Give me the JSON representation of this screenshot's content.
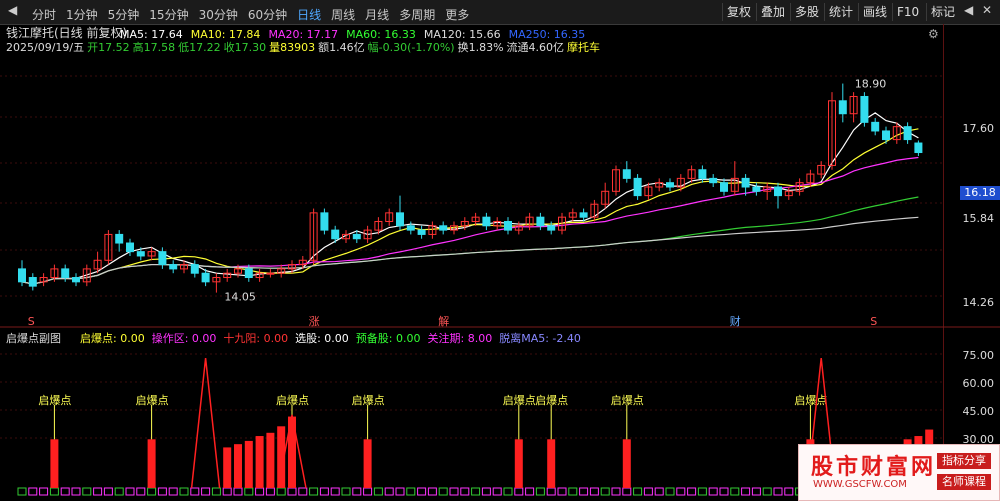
{
  "toolbar": {
    "tabs": [
      "分时",
      "1分钟",
      "5分钟",
      "15分钟",
      "30分钟",
      "60分钟",
      "日线",
      "周线",
      "月线",
      "多周期",
      "更多"
    ],
    "active": "日线",
    "right_buttons": [
      "复权",
      "叠加",
      "多股",
      "统计",
      "画线",
      "F10",
      "标记"
    ]
  },
  "header": {
    "name": "钱江摩托(日线 前复权)",
    "ma_values": [
      {
        "label": "MA5: 17.64",
        "color": "#ffffff"
      },
      {
        "label": "MA10: 17.84",
        "color": "#ffff33"
      },
      {
        "label": "MA20: 17.17",
        "color": "#ff33ff"
      },
      {
        "label": "MA60: 16.33",
        "color": "#33ff33"
      },
      {
        "label": "MA120: 15.66",
        "color": "#dddddd"
      },
      {
        "label": "MA250: 16.35",
        "color": "#3366ff"
      }
    ],
    "quote": [
      {
        "t": "2025/09/19/五",
        "c": "#dddddd"
      },
      {
        "t": "开17.52",
        "c": "#33cc33"
      },
      {
        "t": "高17.58",
        "c": "#33cc33"
      },
      {
        "t": "低17.22",
        "c": "#33cc33"
      },
      {
        "t": "收17.30",
        "c": "#33cc33"
      },
      {
        "t": "量83903",
        "c": "#ffff33"
      },
      {
        "t": "额1.46亿",
        "c": "#dddddd"
      },
      {
        "t": "幅-0.30(-1.70%)",
        "c": "#33cc33"
      },
      {
        "t": "换1.83%",
        "c": "#dddddd"
      },
      {
        "t": "流通4.60亿",
        "c": "#dddddd"
      },
      {
        "t": "摩托车",
        "c": "#ffff33"
      }
    ]
  },
  "price_axis": {
    "labels": [
      "17.60",
      "15.84",
      "14.26"
    ],
    "highlight": "16.18"
  },
  "annotations": {
    "high": "18.90",
    "low": "14.05",
    "events": [
      "S",
      "涨",
      "解",
      "财",
      "S"
    ]
  },
  "sub_header": {
    "title": "启爆点副图",
    "items": [
      {
        "t": "启爆点: 0.00",
        "c": "#ffff33"
      },
      {
        "t": "操作区: 0.00",
        "c": "#ff33ff"
      },
      {
        "t": "十九阳: 0.00",
        "c": "#ff3333"
      },
      {
        "t": "选股: 0.00",
        "c": "#ffffff"
      },
      {
        "t": "预备股: 0.00",
        "c": "#33ff33"
      },
      {
        "t": "关注期: 8.00",
        "c": "#ff33ff"
      },
      {
        "t": "脱离MA5: -2.40",
        "c": "#8888ff"
      }
    ]
  },
  "sub_axis": {
    "labels": [
      "75.00",
      "60.00",
      "45.00",
      "30.00"
    ]
  },
  "signal_label": "启爆点",
  "watermark": {
    "name": "股市财富网",
    "url": "WWW.GSCFW.COM",
    "tag1": "指标分享",
    "tag2": "名师课程"
  },
  "chart_data": {
    "type": "candlestick",
    "y_range": [
      13.6,
      19.4
    ],
    "candles": [
      {
        "o": 14.6,
        "c": 14.3,
        "h": 14.8,
        "l": 14.2
      },
      {
        "o": 14.4,
        "c": 14.2,
        "h": 14.5,
        "l": 14.1
      },
      {
        "o": 14.3,
        "c": 14.4,
        "h": 14.5,
        "l": 14.2
      },
      {
        "o": 14.4,
        "c": 14.6,
        "h": 14.7,
        "l": 14.3
      },
      {
        "o": 14.6,
        "c": 14.4,
        "h": 14.7,
        "l": 14.3
      },
      {
        "o": 14.4,
        "c": 14.3,
        "h": 14.5,
        "l": 14.2
      },
      {
        "o": 14.3,
        "c": 14.6,
        "h": 14.7,
        "l": 14.2
      },
      {
        "o": 14.6,
        "c": 14.8,
        "h": 15.0,
        "l": 14.5
      },
      {
        "o": 14.8,
        "c": 15.4,
        "h": 15.5,
        "l": 14.7
      },
      {
        "o": 15.4,
        "c": 15.2,
        "h": 15.5,
        "l": 15.0
      },
      {
        "o": 15.2,
        "c": 15.0,
        "h": 15.3,
        "l": 14.9
      },
      {
        "o": 15.0,
        "c": 14.9,
        "h": 15.1,
        "l": 14.8
      },
      {
        "o": 14.9,
        "c": 15.0,
        "h": 15.1,
        "l": 14.8
      },
      {
        "o": 15.0,
        "c": 14.7,
        "h": 15.1,
        "l": 14.6
      },
      {
        "o": 14.7,
        "c": 14.6,
        "h": 14.8,
        "l": 14.5
      },
      {
        "o": 14.6,
        "c": 14.7,
        "h": 14.8,
        "l": 14.5
      },
      {
        "o": 14.7,
        "c": 14.5,
        "h": 14.8,
        "l": 14.4
      },
      {
        "o": 14.5,
        "c": 14.3,
        "h": 14.6,
        "l": 14.2
      },
      {
        "o": 14.3,
        "c": 14.4,
        "h": 14.5,
        "l": 14.05
      },
      {
        "o": 14.4,
        "c": 14.5,
        "h": 14.6,
        "l": 14.3
      },
      {
        "o": 14.5,
        "c": 14.6,
        "h": 14.7,
        "l": 14.4
      },
      {
        "o": 14.6,
        "c": 14.4,
        "h": 14.7,
        "l": 14.3
      },
      {
        "o": 14.4,
        "c": 14.5,
        "h": 14.6,
        "l": 14.3
      },
      {
        "o": 14.5,
        "c": 14.5,
        "h": 14.6,
        "l": 14.4
      },
      {
        "o": 14.5,
        "c": 14.6,
        "h": 14.7,
        "l": 14.4
      },
      {
        "o": 14.6,
        "c": 14.7,
        "h": 14.8,
        "l": 14.5
      },
      {
        "o": 14.7,
        "c": 14.8,
        "h": 14.9,
        "l": 14.6
      },
      {
        "o": 14.8,
        "c": 15.9,
        "h": 16.0,
        "l": 14.7
      },
      {
        "o": 15.9,
        "c": 15.5,
        "h": 16.0,
        "l": 15.4
      },
      {
        "o": 15.5,
        "c": 15.3,
        "h": 15.6,
        "l": 15.2
      },
      {
        "o": 15.3,
        "c": 15.4,
        "h": 15.5,
        "l": 15.2
      },
      {
        "o": 15.4,
        "c": 15.3,
        "h": 15.5,
        "l": 15.2
      },
      {
        "o": 15.3,
        "c": 15.5,
        "h": 15.6,
        "l": 15.2
      },
      {
        "o": 15.5,
        "c": 15.7,
        "h": 15.8,
        "l": 15.4
      },
      {
        "o": 15.7,
        "c": 15.9,
        "h": 16.0,
        "l": 15.6
      },
      {
        "o": 15.9,
        "c": 15.6,
        "h": 16.3,
        "l": 15.5
      },
      {
        "o": 15.6,
        "c": 15.5,
        "h": 15.7,
        "l": 15.4
      },
      {
        "o": 15.5,
        "c": 15.4,
        "h": 15.6,
        "l": 15.3
      },
      {
        "o": 15.4,
        "c": 15.6,
        "h": 15.7,
        "l": 15.3
      },
      {
        "o": 15.6,
        "c": 15.5,
        "h": 15.7,
        "l": 15.4
      },
      {
        "o": 15.5,
        "c": 15.6,
        "h": 15.7,
        "l": 15.4
      },
      {
        "o": 15.6,
        "c": 15.7,
        "h": 15.8,
        "l": 15.5
      },
      {
        "o": 15.7,
        "c": 15.8,
        "h": 15.9,
        "l": 15.6
      },
      {
        "o": 15.8,
        "c": 15.6,
        "h": 15.9,
        "l": 15.5
      },
      {
        "o": 15.6,
        "c": 15.7,
        "h": 15.8,
        "l": 15.5
      },
      {
        "o": 15.7,
        "c": 15.5,
        "h": 15.8,
        "l": 15.4
      },
      {
        "o": 15.5,
        "c": 15.6,
        "h": 15.7,
        "l": 15.4
      },
      {
        "o": 15.6,
        "c": 15.8,
        "h": 15.9,
        "l": 15.5
      },
      {
        "o": 15.8,
        "c": 15.6,
        "h": 15.9,
        "l": 15.5
      },
      {
        "o": 15.6,
        "c": 15.5,
        "h": 15.7,
        "l": 15.4
      },
      {
        "o": 15.5,
        "c": 15.8,
        "h": 15.9,
        "l": 15.4
      },
      {
        "o": 15.8,
        "c": 15.9,
        "h": 16.0,
        "l": 15.7
      },
      {
        "o": 15.9,
        "c": 15.8,
        "h": 16.0,
        "l": 15.7
      },
      {
        "o": 15.8,
        "c": 16.1,
        "h": 16.2,
        "l": 15.7
      },
      {
        "o": 16.1,
        "c": 16.4,
        "h": 16.6,
        "l": 16.0
      },
      {
        "o": 16.4,
        "c": 16.9,
        "h": 17.0,
        "l": 16.3
      },
      {
        "o": 16.9,
        "c": 16.7,
        "h": 17.1,
        "l": 16.6
      },
      {
        "o": 16.7,
        "c": 16.3,
        "h": 16.8,
        "l": 16.2
      },
      {
        "o": 16.3,
        "c": 16.5,
        "h": 16.6,
        "l": 16.2
      },
      {
        "o": 16.5,
        "c": 16.6,
        "h": 16.7,
        "l": 16.4
      },
      {
        "o": 16.6,
        "c": 16.5,
        "h": 16.7,
        "l": 16.4
      },
      {
        "o": 16.5,
        "c": 16.7,
        "h": 16.8,
        "l": 16.4
      },
      {
        "o": 16.7,
        "c": 16.9,
        "h": 17.0,
        "l": 16.6
      },
      {
        "o": 16.9,
        "c": 16.7,
        "h": 17.0,
        "l": 16.6
      },
      {
        "o": 16.7,
        "c": 16.6,
        "h": 16.8,
        "l": 16.5
      },
      {
        "o": 16.6,
        "c": 16.4,
        "h": 16.7,
        "l": 16.3
      },
      {
        "o": 16.4,
        "c": 16.7,
        "h": 17.1,
        "l": 16.3
      },
      {
        "o": 16.7,
        "c": 16.5,
        "h": 16.8,
        "l": 16.3
      },
      {
        "o": 16.5,
        "c": 16.4,
        "h": 16.6,
        "l": 16.3
      },
      {
        "o": 16.4,
        "c": 16.5,
        "h": 16.6,
        "l": 16.2
      },
      {
        "o": 16.5,
        "c": 16.3,
        "h": 16.6,
        "l": 16.0
      },
      {
        "o": 16.3,
        "c": 16.4,
        "h": 16.5,
        "l": 16.2
      },
      {
        "o": 16.4,
        "c": 16.6,
        "h": 16.7,
        "l": 16.3
      },
      {
        "o": 16.6,
        "c": 16.8,
        "h": 16.9,
        "l": 16.5
      },
      {
        "o": 16.8,
        "c": 17.0,
        "h": 17.1,
        "l": 16.7
      },
      {
        "o": 17.0,
        "c": 18.5,
        "h": 18.7,
        "l": 16.9
      },
      {
        "o": 18.5,
        "c": 18.2,
        "h": 18.9,
        "l": 18.0
      },
      {
        "o": 18.2,
        "c": 18.6,
        "h": 18.7,
        "l": 18.0
      },
      {
        "o": 18.6,
        "c": 18.0,
        "h": 18.7,
        "l": 17.9
      },
      {
        "o": 18.0,
        "c": 17.8,
        "h": 18.1,
        "l": 17.7
      },
      {
        "o": 17.8,
        "c": 17.6,
        "h": 17.9,
        "l": 17.5
      },
      {
        "o": 17.6,
        "c": 17.9,
        "h": 18.0,
        "l": 17.5
      },
      {
        "o": 17.9,
        "c": 17.6,
        "h": 18.0,
        "l": 17.5
      },
      {
        "o": 17.52,
        "c": 17.3,
        "h": 17.58,
        "l": 17.22
      }
    ],
    "signals": [
      {
        "i": 3,
        "v": 30,
        "label": true
      },
      {
        "i": 12,
        "v": 30,
        "label": true
      },
      {
        "i": 19,
        "v": 25
      },
      {
        "i": 20,
        "v": 27
      },
      {
        "i": 21,
        "v": 29
      },
      {
        "i": 22,
        "v": 32
      },
      {
        "i": 23,
        "v": 34
      },
      {
        "i": 24,
        "v": 38
      },
      {
        "i": 25,
        "v": 44,
        "label": true
      },
      {
        "i": 32,
        "v": 30,
        "label": true
      },
      {
        "i": 46,
        "v": 30,
        "label": true
      },
      {
        "i": 49,
        "v": 30,
        "label": true
      },
      {
        "i": 56,
        "v": 30,
        "label": true
      },
      {
        "i": 73,
        "v": 30,
        "label": true
      },
      {
        "i": 82,
        "v": 30
      },
      {
        "i": 83,
        "v": 32
      },
      {
        "i": 84,
        "v": 36
      }
    ],
    "spikes": [
      {
        "i": 17,
        "v": 80
      },
      {
        "i": 25,
        "v": 45
      },
      {
        "i": 74,
        "v": 80
      }
    ]
  }
}
